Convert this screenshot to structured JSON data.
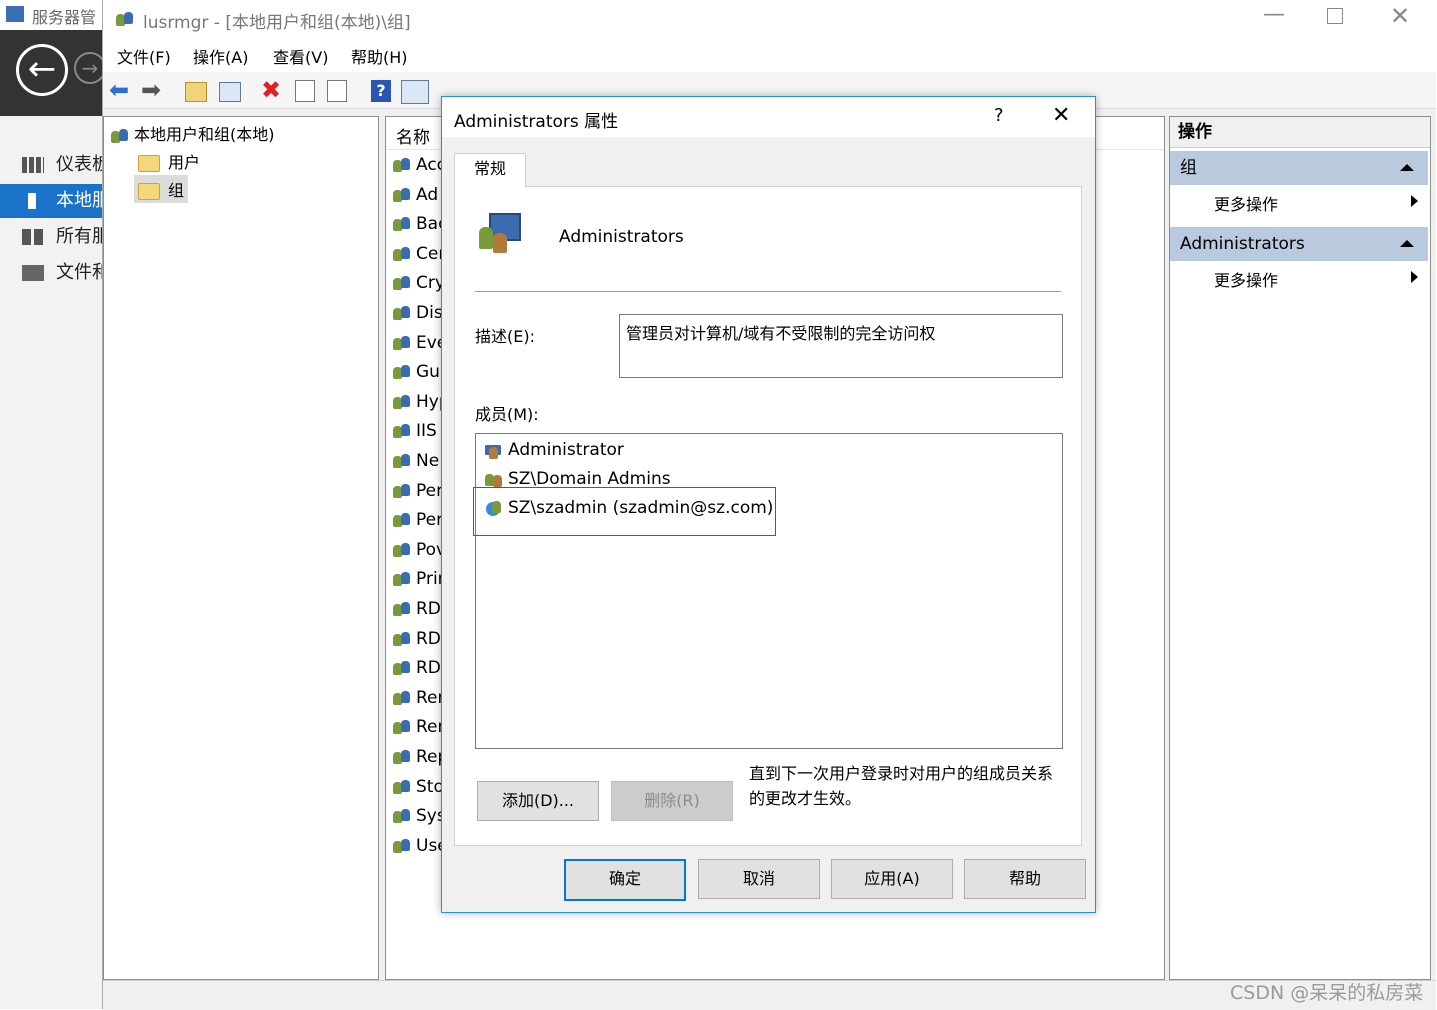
{
  "background_app": {
    "title": "服务器管",
    "sidebar": [
      {
        "label": "仪表板",
        "selected": false
      },
      {
        "label": "本地服",
        "selected": true
      },
      {
        "label": "所有服",
        "selected": false
      },
      {
        "label": "文件和",
        "selected": false
      }
    ]
  },
  "window": {
    "title": "lusrmgr - [本地用户和组(本地)\\组]",
    "menu": [
      "文件(F)",
      "操作(A)",
      "查看(V)",
      "帮助(H)"
    ],
    "tree": {
      "root": "本地用户和组(本地)",
      "children": [
        "用户",
        "组"
      ],
      "selected": "组"
    },
    "list_header": "名称",
    "groups": [
      "Acc",
      "Ad",
      "Bac",
      "Cer",
      "Cry",
      "Dis",
      "Eve",
      "Gu",
      "Hyp",
      "IIS",
      "Ne",
      "Per",
      "Per",
      "Pov",
      "Prir",
      "RD",
      "RD",
      "RD",
      "Rer",
      "Rer",
      "Rep",
      "Sto",
      "Sys",
      "Use"
    ],
    "actions": {
      "header": "操作",
      "sections": [
        {
          "title": "组",
          "item": "更多操作"
        },
        {
          "title": "Administrators",
          "item": "更多操作"
        }
      ]
    }
  },
  "dialog": {
    "title": "Administrators 属性",
    "help_glyph": "?",
    "close_glyph": "✕",
    "tab": "常规",
    "group_name": "Administrators",
    "description_label": "描述(E):",
    "description_value": "管理员对计算机/域有不受限制的完全访问权",
    "members_label": "成员(M):",
    "members": [
      "Administrator",
      "SZ\\Domain Admins",
      "SZ\\szadmin (szadmin@sz.com)"
    ],
    "add_button": "添加(D)...",
    "remove_button": "删除(R)",
    "note": "直到下一次用户登录时对用户的组成员关系的更改才生效。",
    "ok_button": "确定",
    "cancel_button": "取消",
    "apply_button": "应用(A)",
    "help_button": "帮助"
  },
  "watermark": "CSDN @呆呆的私房菜",
  "colors": {
    "accent": "#0078d7",
    "highlight_box": "#e02020",
    "action_header": "#b9c9de",
    "selected_nav": "#1a73c9"
  }
}
